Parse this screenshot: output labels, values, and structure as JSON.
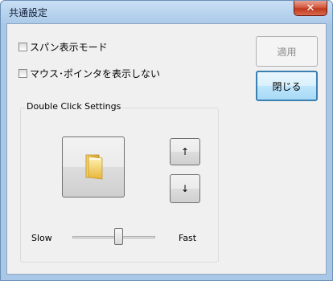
{
  "window": {
    "title": "共通設定",
    "close_label": "✕"
  },
  "options": {
    "span_mode": {
      "label": "スパン表示モード",
      "checked": false
    },
    "hide_pointer": {
      "label": "マウス･ポインタを表示しない",
      "checked": false
    }
  },
  "buttons": {
    "apply": "適用",
    "close": "閉じる",
    "up": "↑",
    "down": "↓"
  },
  "double_click": {
    "group_label": "Double Click Settings",
    "slow_label": "Slow",
    "fast_label": "Fast",
    "speed_level": 0.55
  }
}
